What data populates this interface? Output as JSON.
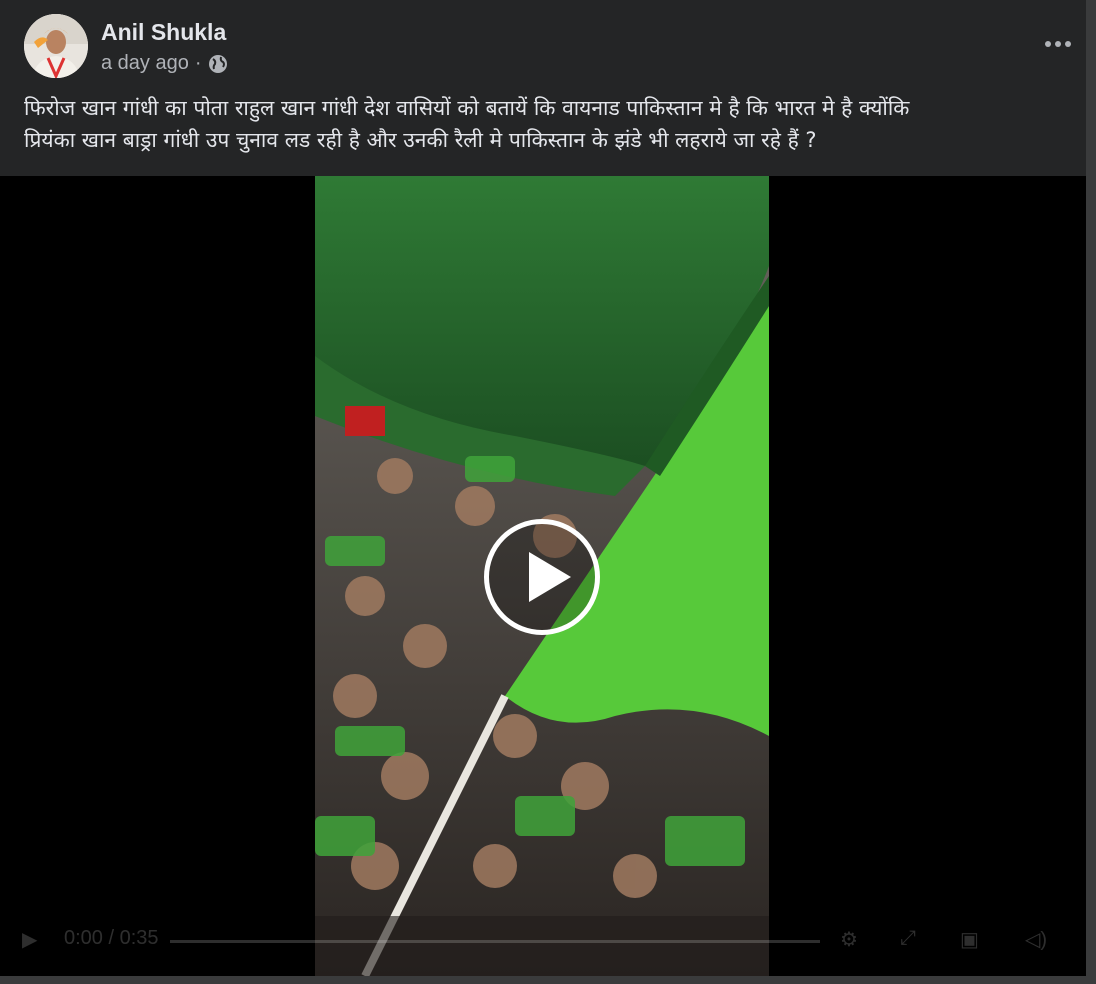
{
  "post": {
    "author": "Anil Shukla",
    "timestamp": "a day ago",
    "separator": "·",
    "privacy_icon": "globe-icon",
    "more_icon": "more-options-icon",
    "more_label": "•••",
    "caption_line1": "फिरोज खान गांधी का पोता राहुल खान गांधी देश वासियों को बतायें कि वायनाड पाकिस्तान मे है कि भारत मे है क्योंकि",
    "caption_line2": "प्रियंका खान बाड्रा गांधी उप चुनाव लड रही है और उनकी रैली मे पाकिस्तान के झंडे भी लहराये जा रहे हैं ?"
  },
  "video": {
    "play_icon": "play-icon",
    "time": "0:00 / 0:35"
  },
  "colors": {
    "background": "#242526",
    "text_primary": "#e4e6eb",
    "text_secondary": "#b0b3b8",
    "flag_green": "#57c93a"
  }
}
